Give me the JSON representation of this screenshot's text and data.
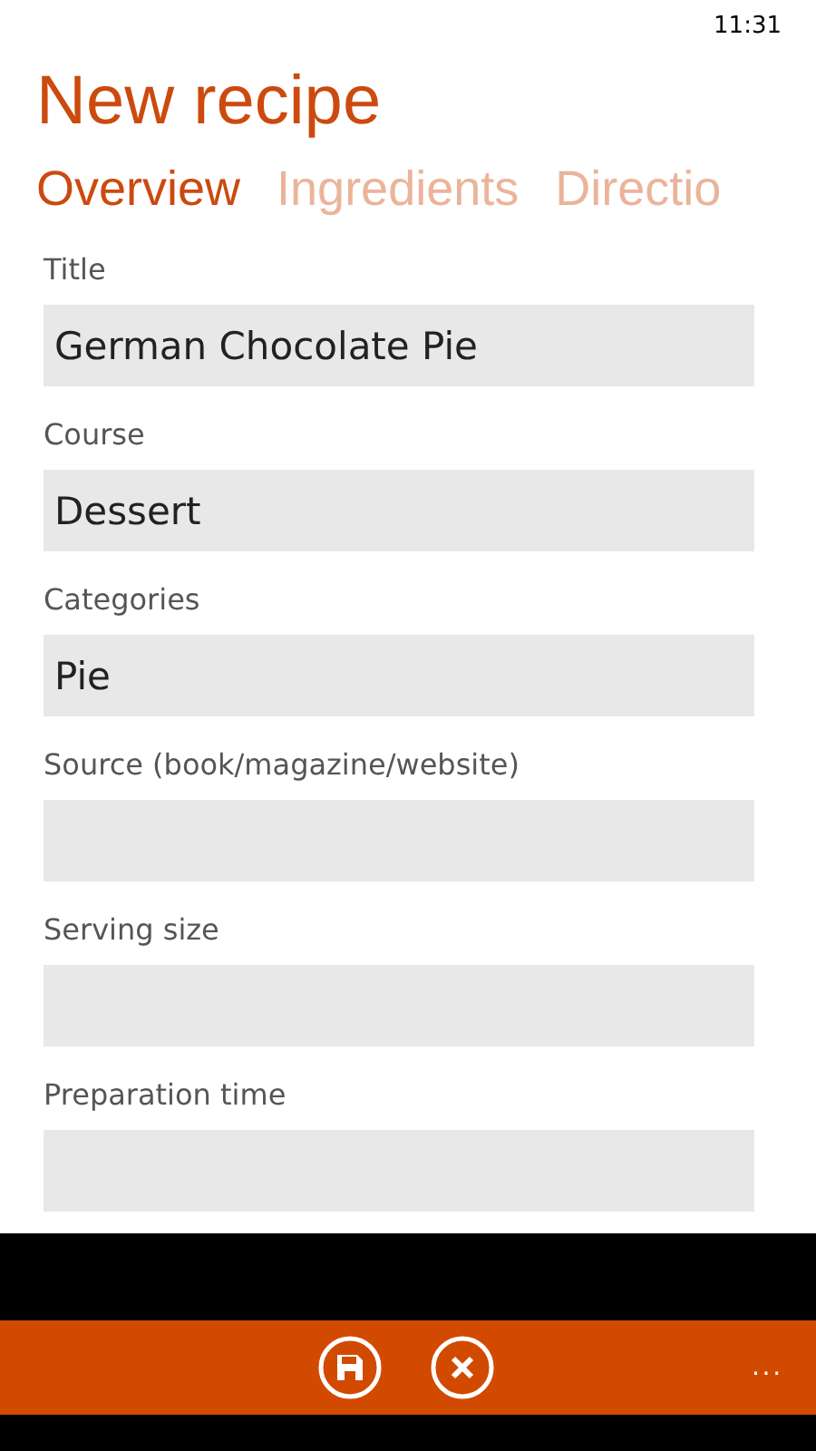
{
  "status_bar": {
    "time": "11:31"
  },
  "title": "New recipe",
  "tabs": [
    {
      "label": "Overview",
      "selected": true
    },
    {
      "label": "Ingredients",
      "selected": false
    },
    {
      "label": "Directio",
      "selected": false
    }
  ],
  "fields": [
    {
      "label": "Title",
      "value": "German Chocolate Pie"
    },
    {
      "label": "Course",
      "value": "Dessert"
    },
    {
      "label": "Categories",
      "value": "Pie"
    },
    {
      "label": "Source (book/magazine/website)"
    },
    {
      "label": "Serving size"
    },
    {
      "label": "Preparation time"
    }
  ],
  "app_bar": {
    "more": "..."
  }
}
